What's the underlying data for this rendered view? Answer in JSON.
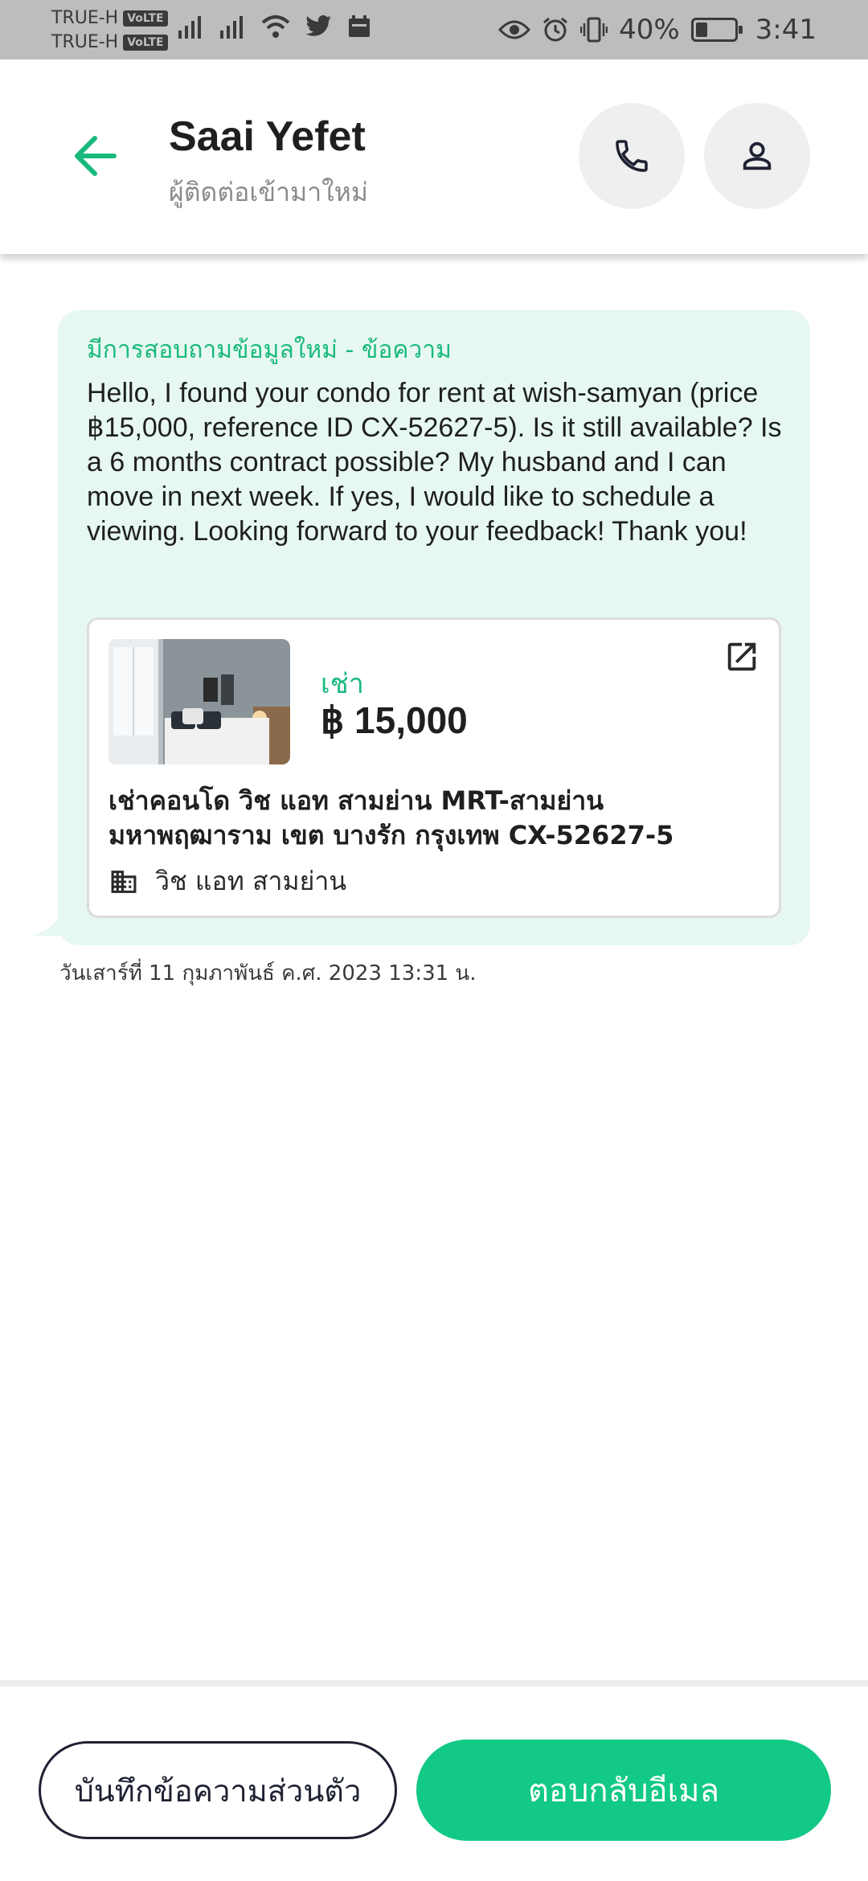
{
  "status_bar": {
    "carrier_1": "TRUE-H",
    "carrier_2": "TRUE-H",
    "volte": "VoLTE",
    "battery": "40%",
    "battery_level": 0.4,
    "time": "3:41"
  },
  "header": {
    "contact_name": "Saai Yefet",
    "contact_status": "ผู้ติดต่อเข้ามาใหม่"
  },
  "message": {
    "inquiry_title": "มีการสอบถามข้อมูลใหม่ - ข้อความ",
    "body": "Hello, I found your condo for rent at wish-samyan (price ฿15,000, reference ID CX-52627-5). Is it still available? Is a 6 months contract possible? My husband and I can move in next week. If yes, I would like to schedule a viewing. Looking forward to your feedback! Thank you!",
    "timestamp": "วันเสาร์ที่ 11 กุมภาพันธ์ ค.ศ. 2023 13:31 น."
  },
  "listing": {
    "type": "เช่า",
    "price": "฿ 15,000",
    "title": "เช่าคอนโด  วิช แอท สามย่าน MRT-สามย่าน มหาพฤฒาราม เขต บางรัก กรุงเทพ CX-52627-5",
    "building": "วิช แอท สามย่าน"
  },
  "actions": {
    "private_note": "บันทึกข้อความส่วนตัว",
    "reply_email": "ตอบกลับอีเมล"
  },
  "colors": {
    "accent": "#12c985",
    "bubble": "#e6f8f1",
    "status_bar": "#bdbdbd"
  },
  "icons": {
    "back": "arrow-left-icon",
    "call": "phone-icon",
    "profile": "person-icon",
    "open": "open-external-icon",
    "building": "building-icon"
  }
}
